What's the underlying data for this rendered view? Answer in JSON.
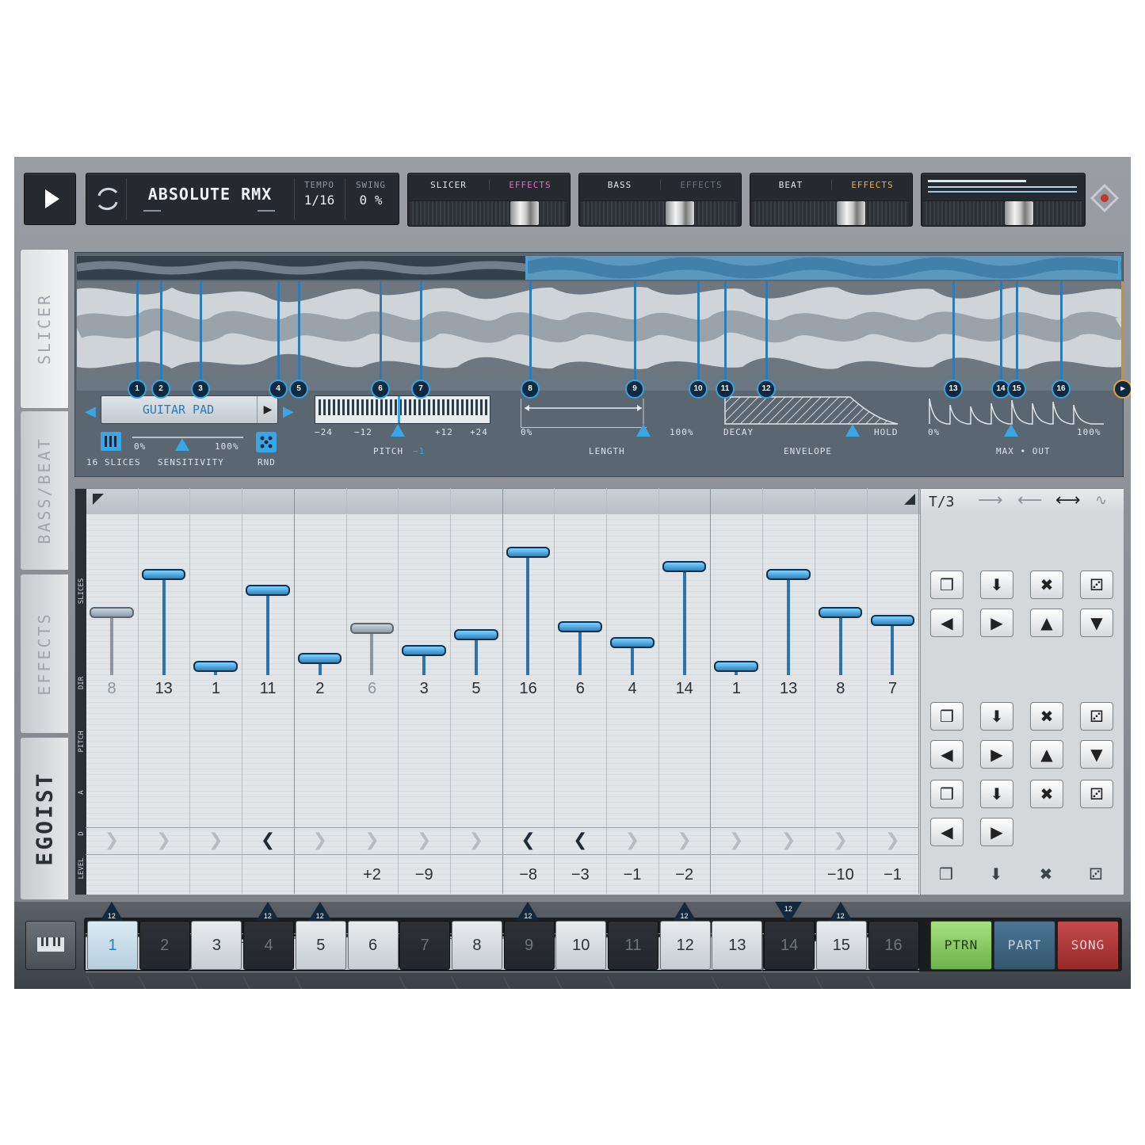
{
  "transport": {
    "play_icon": "play-icon"
  },
  "pattern": {
    "name": "ABSOLUTE RMX",
    "tempo_label": "TEMPO",
    "tempo_value": "1/16",
    "swing_label": "SWING",
    "swing_value": "0 %"
  },
  "channels": [
    {
      "name": "SLICER",
      "effects": "EFFECTS",
      "effects_active": true
    },
    {
      "name": "BASS",
      "effects": "EFFECTS",
      "effects_active": false
    },
    {
      "name": "BEAT",
      "effects": "EFFECTS",
      "effects_active": true
    }
  ],
  "side_tabs": [
    "SLICER",
    "BASS/BEAT",
    "EFFECTS",
    "EGOIST"
  ],
  "slicer": {
    "markers": [
      "1",
      "2",
      "3",
      "4",
      "5",
      "6",
      "7",
      "8",
      "9",
      "10",
      "11",
      "12",
      "13",
      "14",
      "15",
      "16"
    ],
    "sample_name": "GUITAR PAD",
    "slices_label": "16 SLICES",
    "sensitivity": {
      "label": "SENSITIVITY",
      "min": "0%",
      "max": "100%"
    },
    "rnd_label": "RND",
    "pitch": {
      "label": "PITCH",
      "value": "−1",
      "ticks": [
        "−24",
        "−12",
        "0",
        "+12",
        "+24"
      ]
    },
    "length": {
      "label": "LENGTH",
      "min": "0%",
      "max": "100%"
    },
    "envelope": {
      "label": "ENVELOPE",
      "min": "DECAY",
      "max": "HOLD"
    },
    "maxout": {
      "label": "MAX • OUT",
      "min": "0%",
      "max": "100%"
    }
  },
  "sequencer": {
    "row_labels": {
      "slices": "SLICES",
      "dir": "DIR",
      "pitch": "PITCH",
      "a": "A",
      "d": "D",
      "level": "LEVEL"
    },
    "slices": [
      "8",
      "13",
      "1",
      "11",
      "2",
      "6",
      "3",
      "5",
      "16",
      "6",
      "4",
      "14",
      "1",
      "13",
      "8",
      "7"
    ],
    "dir": [
      "right",
      "right",
      "right",
      "left",
      "right",
      "right",
      "right",
      "right",
      "left",
      "left",
      "right",
      "right",
      "right",
      "right",
      "right",
      "right"
    ],
    "pitch": [
      "",
      "",
      "",
      "",
      "",
      "+2",
      "−9",
      "",
      "−8",
      "−3",
      "−1",
      "−2",
      "",
      "",
      "−10",
      "−1"
    ],
    "octave": [
      "up",
      "",
      "",
      "up",
      "up",
      "",
      "",
      "",
      "up",
      "",
      "",
      "up",
      "",
      "down",
      "up",
      ""
    ],
    "octave_label": "12",
    "play_mode": {
      "label": "T/3",
      "icons": [
        "arrow-right-icon",
        "arrow-left-icon",
        "arrow-bidirectional-icon",
        "random-walk-icon"
      ]
    }
  },
  "steps": [
    "1",
    "2",
    "3",
    "4",
    "5",
    "6",
    "7",
    "8",
    "9",
    "10",
    "11",
    "12",
    "13",
    "14",
    "15",
    "16"
  ],
  "modes": {
    "ptrn": "PTRN",
    "part": "PART",
    "song": "SONG"
  },
  "colors": {
    "accent": "#39a2e0",
    "ptrn": "#8fd06a",
    "part": "#3f6885",
    "song": "#b13a3a"
  }
}
